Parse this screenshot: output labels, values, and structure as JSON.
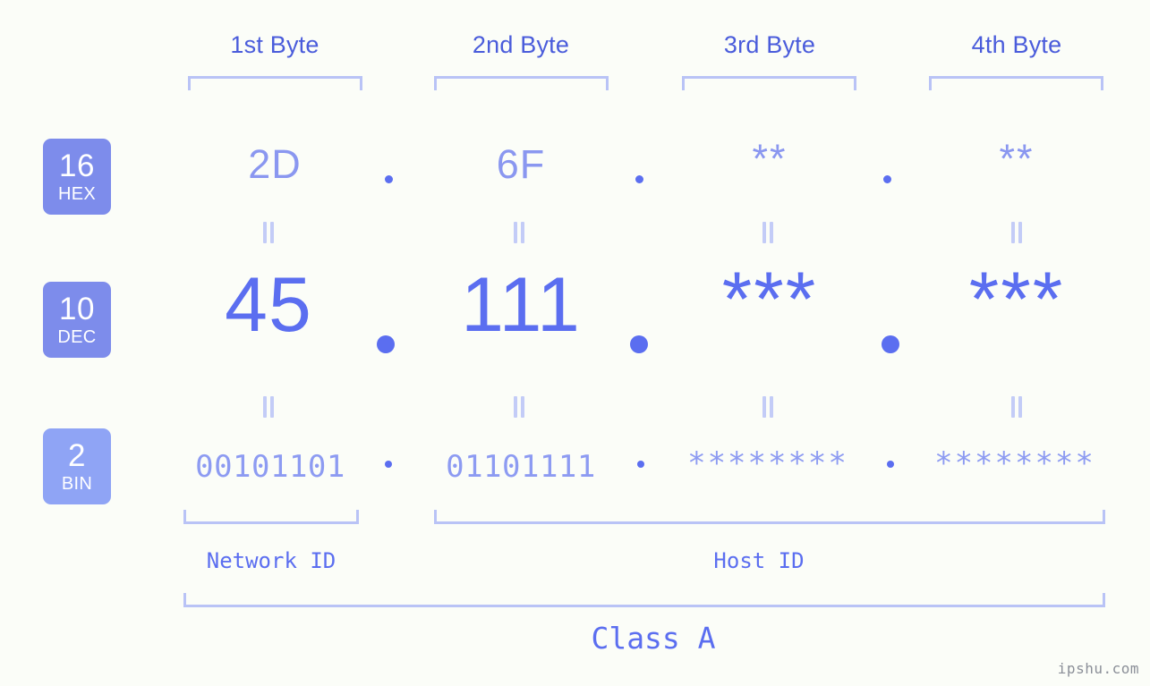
{
  "watermark": "ipshu.com",
  "byte_headers": [
    {
      "label": "1st Byte"
    },
    {
      "label": "2nd Byte"
    },
    {
      "label": "3rd Byte"
    },
    {
      "label": "4th Byte"
    }
  ],
  "rows": [
    {
      "base_number": "16",
      "base_label": "HEX",
      "values": [
        "2D",
        "6F",
        "**",
        "**"
      ],
      "separator": "."
    },
    {
      "base_number": "10",
      "base_label": "DEC",
      "values": [
        "45",
        "111",
        "***",
        "***"
      ],
      "separator": "."
    },
    {
      "base_number": "2",
      "base_label": "BIN",
      "values": [
        "00101101",
        "01101111",
        "********",
        "********"
      ],
      "separator": "."
    }
  ],
  "segments": {
    "network_id": "Network ID",
    "host_id": "Host ID",
    "class": "Class A"
  },
  "colors": {
    "background": "#fbfdf8",
    "header_blue": "#4a5cdb",
    "bracket_lavender": "#b9c3f6",
    "badge_fill": "#7d8ceb",
    "badge_fill_bin": "#8fa4f5",
    "hex_value": "#8a97f0",
    "dec_value": "#5b6ef0",
    "bin_value": "#8d9bf2",
    "connector": "#c3ccf7",
    "watermark": "#8b8f98"
  }
}
